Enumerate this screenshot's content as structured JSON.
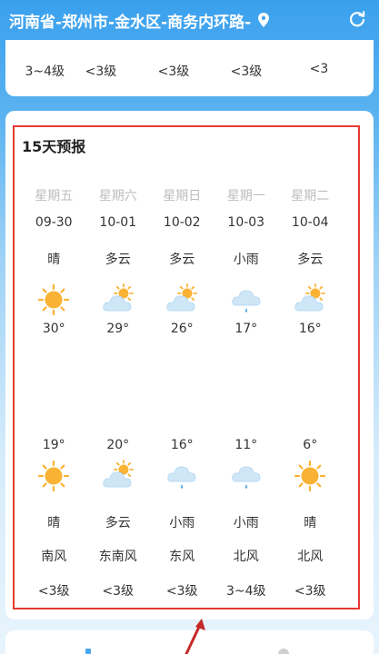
{
  "header": {
    "location": "河南省-郑州市-金水区-商务内环路-"
  },
  "top_card": {
    "wind_levels": [
      "3~4级",
      "<3级",
      "<3级",
      "<3级",
      "<3"
    ]
  },
  "forecast": {
    "title": "15天预报",
    "days": [
      {
        "weekday": "星期五",
        "date": "09-30",
        "cond_day": "晴",
        "icon_day": "sun-icon",
        "high": "30°",
        "low": "19°",
        "icon_night": "sun-icon",
        "cond_night": "晴",
        "wind_dir": "南风",
        "wind_level": "<3级"
      },
      {
        "weekday": "星期六",
        "date": "10-01",
        "cond_day": "多云",
        "icon_day": "partly-cloudy-icon",
        "high": "29°",
        "low": "20°",
        "icon_night": "partly-cloudy-icon",
        "cond_night": "多云",
        "wind_dir": "东南风",
        "wind_level": "<3级"
      },
      {
        "weekday": "星期日",
        "date": "10-02",
        "cond_day": "多云",
        "icon_day": "partly-cloudy-icon",
        "high": "26°",
        "low": "16°",
        "icon_night": "light-rain-icon",
        "cond_night": "小雨",
        "wind_dir": "东风",
        "wind_level": "<3级"
      },
      {
        "weekday": "星期一",
        "date": "10-03",
        "cond_day": "小雨",
        "icon_day": "light-rain-icon",
        "high": "17°",
        "low": "11°",
        "icon_night": "light-rain-icon",
        "cond_night": "小雨",
        "wind_dir": "北风",
        "wind_level": "3~4级"
      },
      {
        "weekday": "星期二",
        "date": "10-04",
        "cond_day": "多云",
        "icon_day": "partly-cloudy-icon",
        "high": "16°",
        "low": "6°",
        "icon_night": "sun-icon",
        "cond_night": "晴",
        "wind_dir": "北风",
        "wind_level": "<3级"
      }
    ]
  },
  "colors": {
    "highlight": "#e53935",
    "sun": "#f9b233",
    "cloud": "#cfe6f7"
  }
}
